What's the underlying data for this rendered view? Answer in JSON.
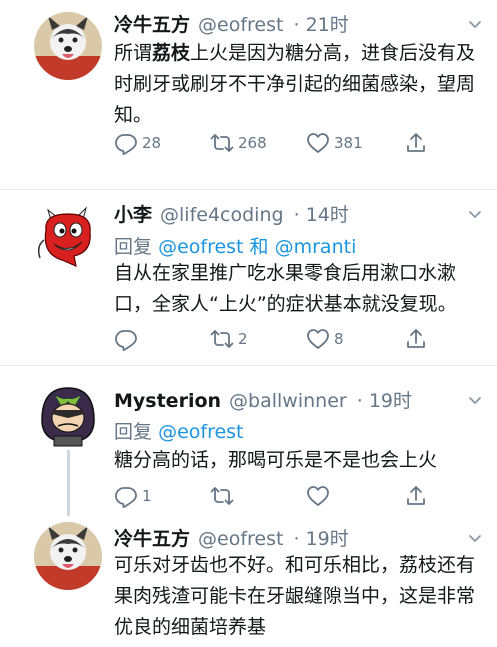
{
  "tweets": [
    {
      "name": "冷牛五方",
      "handle": "@eofrest",
      "time": "· 21时",
      "text_pre": "所谓",
      "text_bold": "荔枝",
      "text_post": "上火是因为糖分高，进食后没有及时刷牙或刷牙不干净引起的细菌感染，望周知。",
      "replies": "28",
      "retweets": "268",
      "likes": "381"
    },
    {
      "name": "小李",
      "handle": "@life4coding",
      "time": "· 14时",
      "reply_prefix": "回复",
      "reply_user1": "@eofrest",
      "reply_and": "和",
      "reply_user2": "@mranti",
      "text": "自从在家里推广吃水果零食后用漱口水漱口，全家人“上火”的症状基本就没复现。",
      "replies": "",
      "retweets": "2",
      "likes": "8"
    },
    {
      "name": "Mysterion",
      "handle": "@ballwinner",
      "time": "· 19时",
      "reply_prefix": "回复",
      "reply_user1": "@eofrest",
      "text": "糖分高的话，那喝可乐是不是也会上火",
      "replies": "1",
      "retweets": "",
      "likes": ""
    },
    {
      "name": "冷牛五方",
      "handle": "@eofrest",
      "time": "· 19时",
      "text": "可乐对牙齿也不好。和可乐相比，荔枝还有果肉残渣可能卡在牙龈缝隙当中，这是非常优良的细菌培养基"
    }
  ],
  "icons": {
    "reply": "reply-icon",
    "retweet": "retweet-icon",
    "like": "heart-icon",
    "share": "share-icon",
    "more": "chevron-down-icon"
  },
  "colors": {
    "link": "#1b95e0",
    "muted": "#657786",
    "text": "#14171a"
  }
}
